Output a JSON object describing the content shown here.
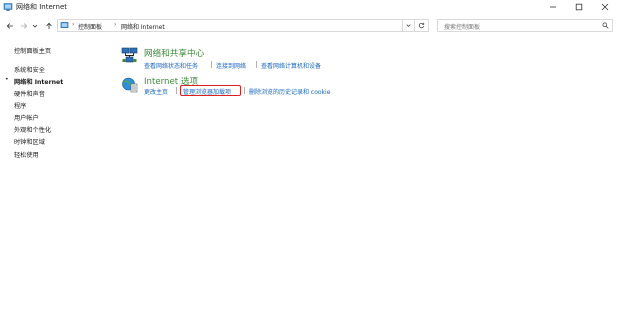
{
  "window": {
    "title": "网络和 Internet",
    "controls": [
      "minimize-icon",
      "maximize-icon",
      "close-icon"
    ]
  },
  "address_bar": {
    "breadcrumbs": [
      "控制面板",
      "网络和 Internet"
    ],
    "search_placeholder": "搜索控制面板"
  },
  "sidebar": {
    "items": [
      {
        "label": "控制面板主页",
        "current": false
      },
      {
        "label": "系统和安全",
        "current": false
      },
      {
        "label": "网络和 Internet",
        "current": true
      },
      {
        "label": "硬件和声音",
        "current": false
      },
      {
        "label": "程序",
        "current": false
      },
      {
        "label": "用户帐户",
        "current": false
      },
      {
        "label": "外观和个性化",
        "current": false
      },
      {
        "label": "时钟和区域",
        "current": false
      },
      {
        "label": "轻松使用",
        "current": false
      }
    ]
  },
  "categories": [
    {
      "title": "网络和共享中心",
      "icon": "network-sharing-icon",
      "links": [
        "查看网络状态和任务",
        "连接到网络",
        "查看网络计算机和设备"
      ]
    },
    {
      "title": "Internet 选项",
      "icon": "internet-options-icon",
      "links": [
        "更改主页",
        "管理浏览器加载项",
        "删除浏览的历史记录和 cookie"
      ],
      "highlighted_link": "管理浏览器加载项"
    }
  ],
  "colors": {
    "category_title": "#3c8a3c",
    "link": "#1565c0",
    "highlight_box": "#e02020"
  }
}
